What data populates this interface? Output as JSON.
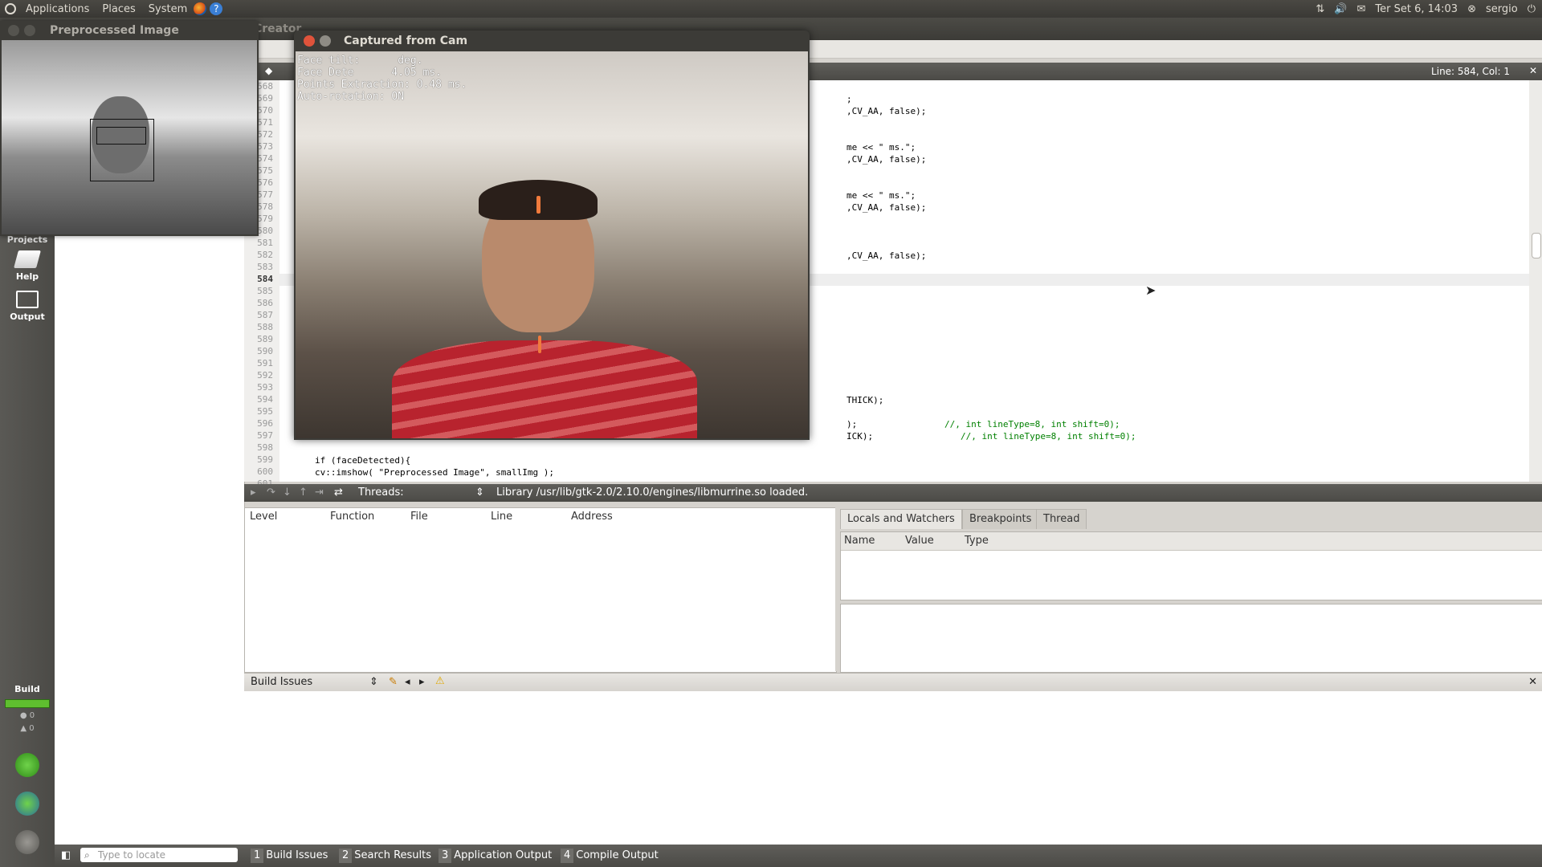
{
  "top_panel": {
    "menus": [
      "Applications",
      "Places",
      "System"
    ],
    "datetime": "Ter Set  6, 14:03",
    "user": "sergio"
  },
  "qt_window": {
    "title": "Creator"
  },
  "modebar": {
    "projects_label": "Projects",
    "help_label": "Help",
    "output_label": "Output",
    "build_label": "Build",
    "errors_count": "0",
    "warnings_count": "0"
  },
  "editor": {
    "line_col": "Line: 584, Col: 1",
    "current_line": "584",
    "line_numbers": [
      "568",
      "569",
      "570",
      "571",
      "572",
      "573",
      "574",
      "575",
      "576",
      "577",
      "578",
      "579",
      "580",
      "581",
      "582",
      "583",
      "584",
      "585",
      "586",
      "587",
      "588",
      "589",
      "590",
      "591",
      "592",
      "593",
      "594",
      "595",
      "596",
      "597",
      "598",
      "599",
      "600",
      "601"
    ],
    "code_fragments": [
      {
        "text": ";"
      },
      {
        "text": ",CV_AA, false);"
      },
      {
        "text": "me << \" ms.\";"
      },
      {
        "text": ",CV_AA, false);"
      },
      {
        "text": "me << \" ms.\";"
      },
      {
        "text": ",CV_AA, false);"
      },
      {
        "text": ",CV_AA, false);"
      },
      {
        "text": "THICK);"
      },
      {
        "text": ");"
      },
      {
        "text": "ICK);"
      },
      {
        "text": "//, int lineType=8, int shift=0);"
      },
      {
        "text": "//, int lineType=8, int shift=0);"
      },
      {
        "text": "if (faceDetected){"
      },
      {
        "text": "cv::imshow( \"Preprocessed Image\", smallImg );"
      }
    ]
  },
  "debugger": {
    "threads_label": "Threads:",
    "status_message": "Library /usr/lib/gtk-2.0/2.10.0/engines/libmurrine.so loaded.",
    "stack_columns": [
      "Level",
      "Function",
      "File",
      "Line",
      "Address"
    ],
    "tabs": [
      "Locals and Watchers",
      "Breakpoints",
      "Thread"
    ],
    "locals_columns": [
      "Name",
      "Value",
      "Type"
    ]
  },
  "build_issues": {
    "title": "Build Issues"
  },
  "statusbar": {
    "locate_placeholder": "Type to locate",
    "panes": [
      {
        "num": "1",
        "label": "Build Issues"
      },
      {
        "num": "2",
        "label": "Search Results"
      },
      {
        "num": "3",
        "label": "Application Output"
      },
      {
        "num": "4",
        "label": "Compile Output"
      }
    ]
  },
  "preprocessed_window": {
    "title": "Preprocessed Image"
  },
  "cam_window": {
    "title": "Captured from Cam",
    "overlay": [
      "Face tilt:      deg.",
      "Face Dete      4.05 ms.",
      "Points Extraction: 0.48 ms.",
      "Auto-rotation: ON"
    ]
  },
  "colors": {
    "panel_bg": "#3c3b37",
    "accent_green": "#5fbf2f",
    "close_red": "#e0533b"
  }
}
